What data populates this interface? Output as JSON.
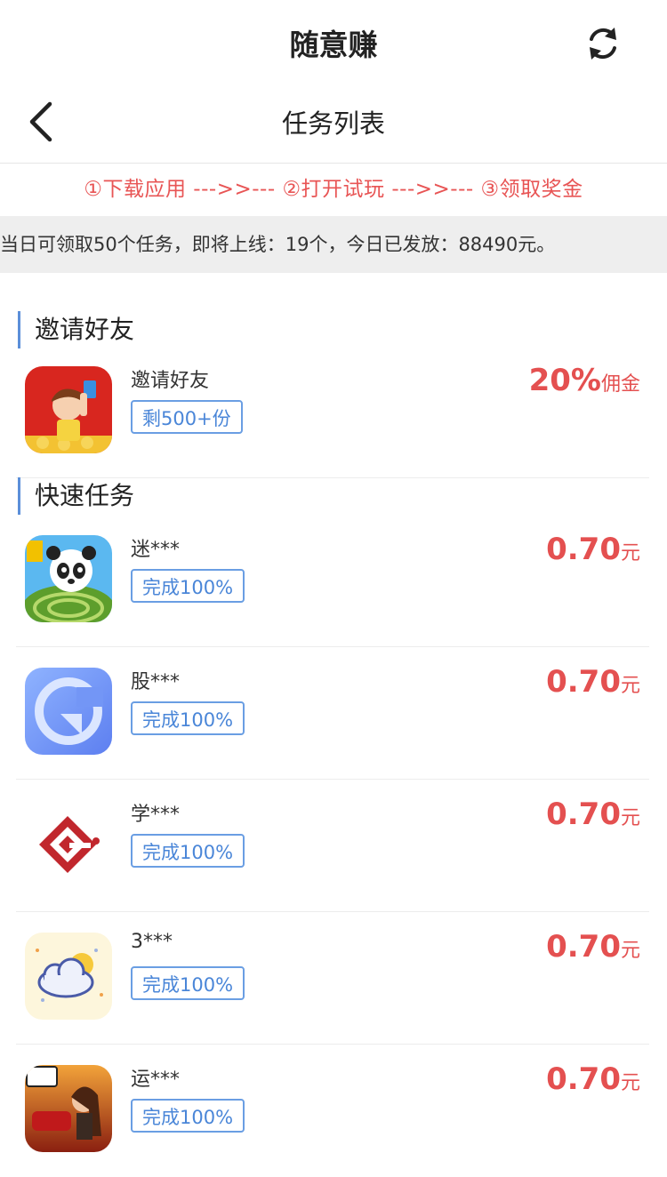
{
  "header": {
    "app_title": "随意赚",
    "refresh_icon": "refresh-icon"
  },
  "nav": {
    "title": "任务列表",
    "back_icon": "back-arrow-icon"
  },
  "steps_text": "①下载应用 --->>--- ②打开试玩 --->>--- ③领取奖金",
  "notice_text": "当日可领取50个任务，即将上线：19个，今日已发放：88490元。",
  "colors": {
    "accent_red": "#e45050",
    "tag_blue": "#4a86d8",
    "section_bar": "#5b8fd9"
  },
  "sections": [
    {
      "title": "邀请好友",
      "tasks": [
        {
          "name": "邀请好友",
          "tag": "剩500+份",
          "amount": "20%",
          "unit": "佣金",
          "icon": "invite-app-icon"
        }
      ]
    },
    {
      "title": "快速任务",
      "tasks": [
        {
          "name": "迷***",
          "tag": "完成100%",
          "amount": "0.70",
          "unit": "元",
          "icon": "panda-maze-app-icon"
        },
        {
          "name": "股***",
          "tag": "完成100%",
          "amount": "0.70",
          "unit": "元",
          "icon": "stock-app-icon"
        },
        {
          "name": "学***",
          "tag": "完成100%",
          "amount": "0.70",
          "unit": "元",
          "icon": "study-app-icon"
        },
        {
          "name": "3***",
          "tag": "完成100%",
          "amount": "0.70",
          "unit": "元",
          "icon": "weather-app-icon"
        },
        {
          "name": "运***",
          "tag": "完成100%",
          "amount": "0.70",
          "unit": "元",
          "icon": "racing-game-app-icon"
        }
      ]
    }
  ]
}
